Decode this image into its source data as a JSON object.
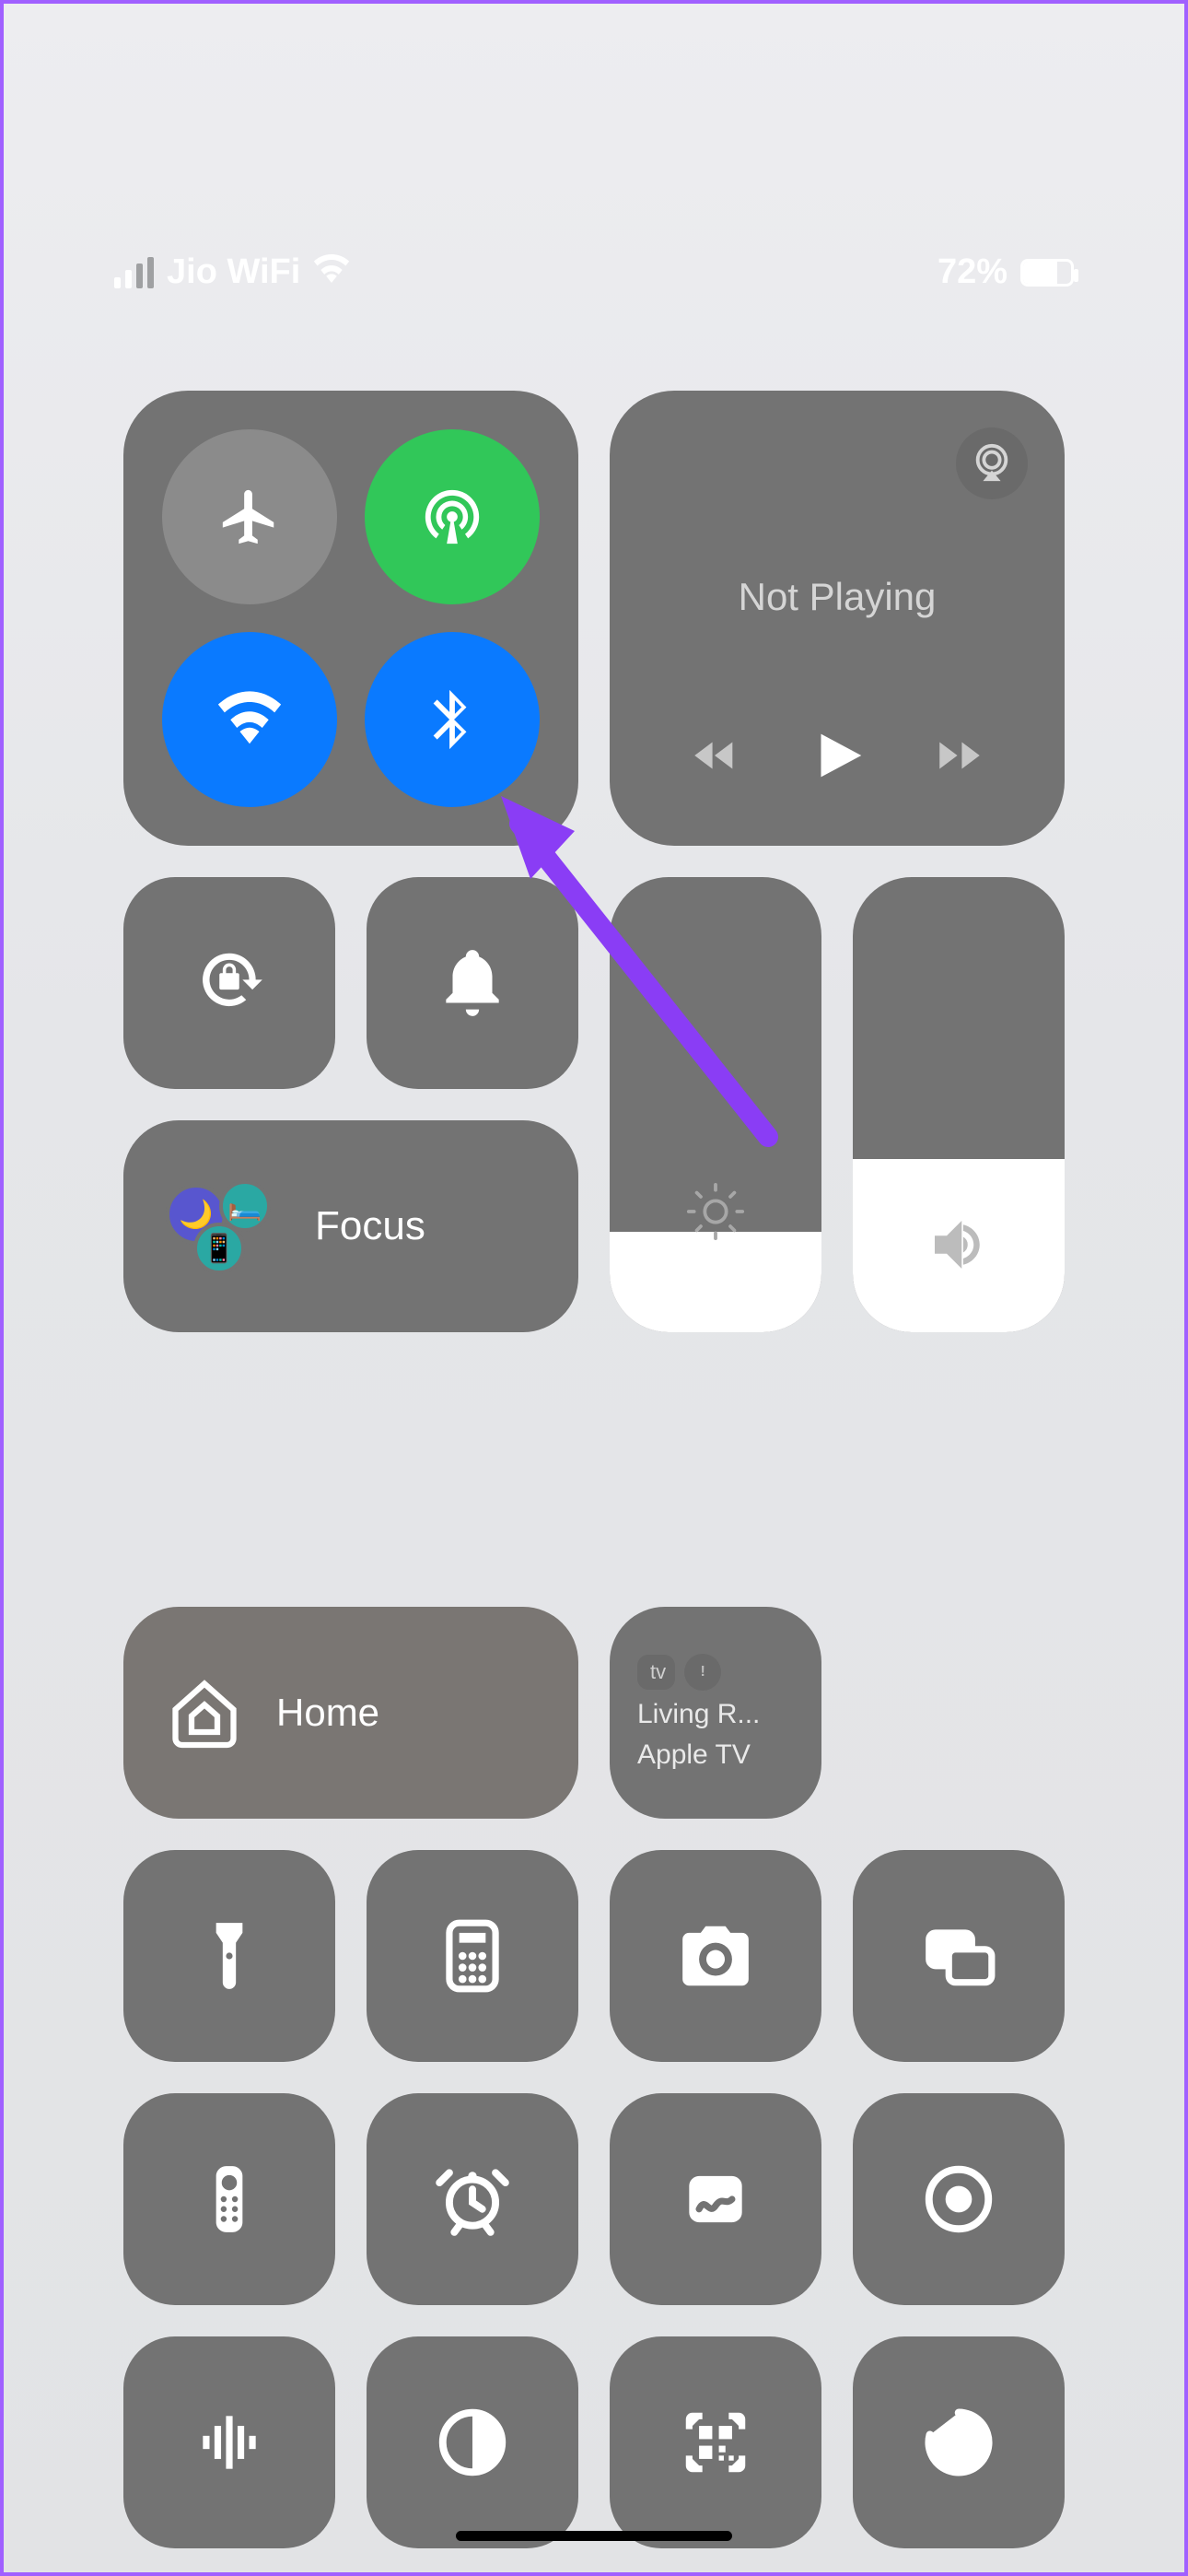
{
  "status": {
    "carrier": "Jio WiFi",
    "battery_percent": "72%"
  },
  "connectivity": {
    "airplane": {
      "name": "airplane-mode-toggle",
      "state": "off"
    },
    "cellular": {
      "name": "cellular-data-toggle",
      "state": "on"
    },
    "wifi": {
      "name": "wifi-toggle",
      "state": "on"
    },
    "bluetooth": {
      "name": "bluetooth-toggle",
      "state": "on"
    }
  },
  "media": {
    "now_playing": "Not Playing"
  },
  "focus": {
    "label": "Focus"
  },
  "home": {
    "label": "Home"
  },
  "apple_tv": {
    "badge": "tv",
    "line1": "Living R...",
    "line2": "Apple TV"
  },
  "sliders": {
    "brightness_pct": 22,
    "volume_pct": 38
  },
  "shortcuts": [
    {
      "name": "flashlight-button"
    },
    {
      "name": "calculator-button"
    },
    {
      "name": "camera-button"
    },
    {
      "name": "screen-mirroring-button"
    },
    {
      "name": "apple-tv-remote-button"
    },
    {
      "name": "alarm-button"
    },
    {
      "name": "freeform-button"
    },
    {
      "name": "screen-record-button"
    },
    {
      "name": "shazam-button"
    },
    {
      "name": "dark-mode-button"
    },
    {
      "name": "qr-scanner-button"
    },
    {
      "name": "timer-button"
    }
  ]
}
